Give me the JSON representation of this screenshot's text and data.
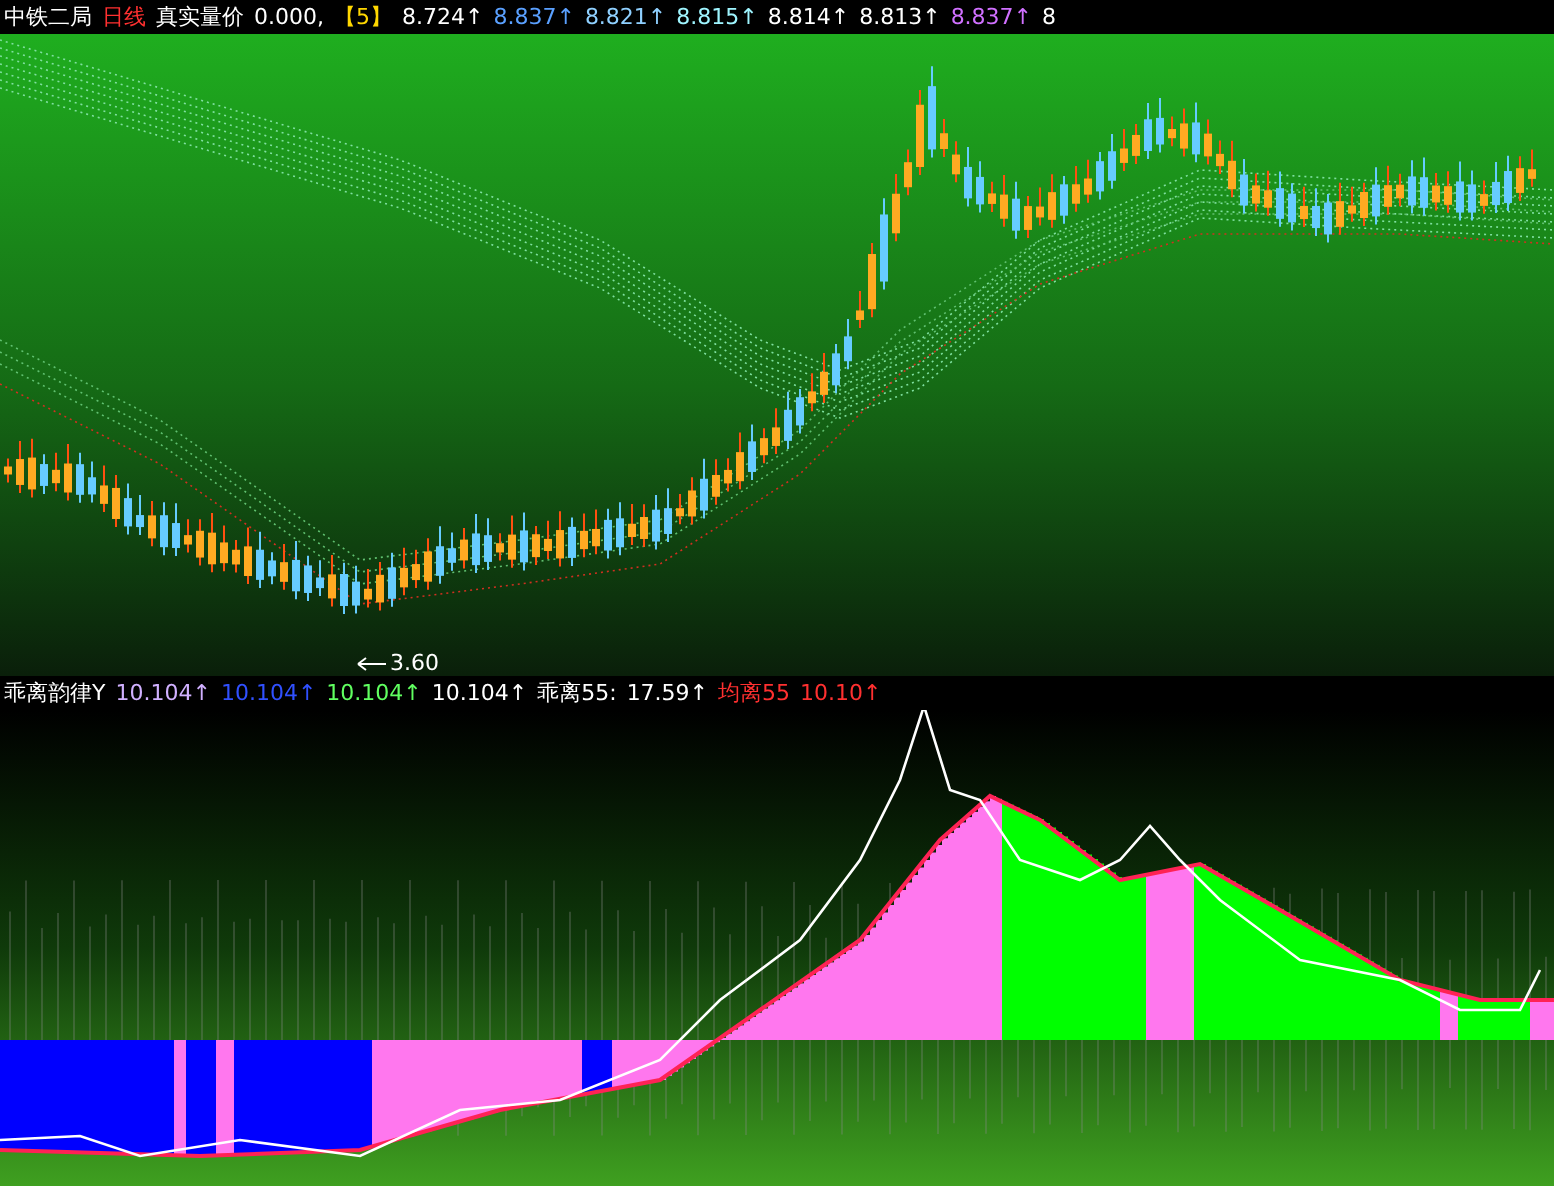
{
  "main_header": {
    "items": [
      {
        "text": "中铁二局",
        "color": "#ffffff"
      },
      {
        "text": "日线",
        "color": "#ff3030"
      },
      {
        "text": "真实量价",
        "color": "#ffffff"
      },
      {
        "text": "0.000,",
        "color": "#ffffff"
      },
      {
        "text": "【5】",
        "color": "#ffd700"
      },
      {
        "text": "8.724↑",
        "color": "#ffffff"
      },
      {
        "text": "8.837↑",
        "color": "#5aa0ff"
      },
      {
        "text": "8.821↑",
        "color": "#8fd0ff"
      },
      {
        "text": "8.815↑",
        "color": "#9ff5ff"
      },
      {
        "text": "8.814↑",
        "color": "#ffffff"
      },
      {
        "text": "8.813↑",
        "color": "#ffffff"
      },
      {
        "text": "8.837↑",
        "color": "#d070ff"
      },
      {
        "text": "8",
        "color": "#ffffff"
      }
    ]
  },
  "price_label": "3.60",
  "sub_header": {
    "items": [
      {
        "text": "乖离韵律Y",
        "color": "#ffffff"
      },
      {
        "text": "10.104↑",
        "color": "#d0b0ff"
      },
      {
        "text": "10.104↑",
        "color": "#3050ff"
      },
      {
        "text": "10.104↑",
        "color": "#60ff60"
      },
      {
        "text": "10.104↑",
        "color": "#ffffff"
      },
      {
        "text": "乖离55:",
        "color": "#ffffff"
      },
      {
        "text": "17.59↑",
        "color": "#ffffff"
      },
      {
        "text": "均离55",
        "color": "#ff3030"
      },
      {
        "text": "10.10↑",
        "color": "#ff3030"
      }
    ]
  }
}
